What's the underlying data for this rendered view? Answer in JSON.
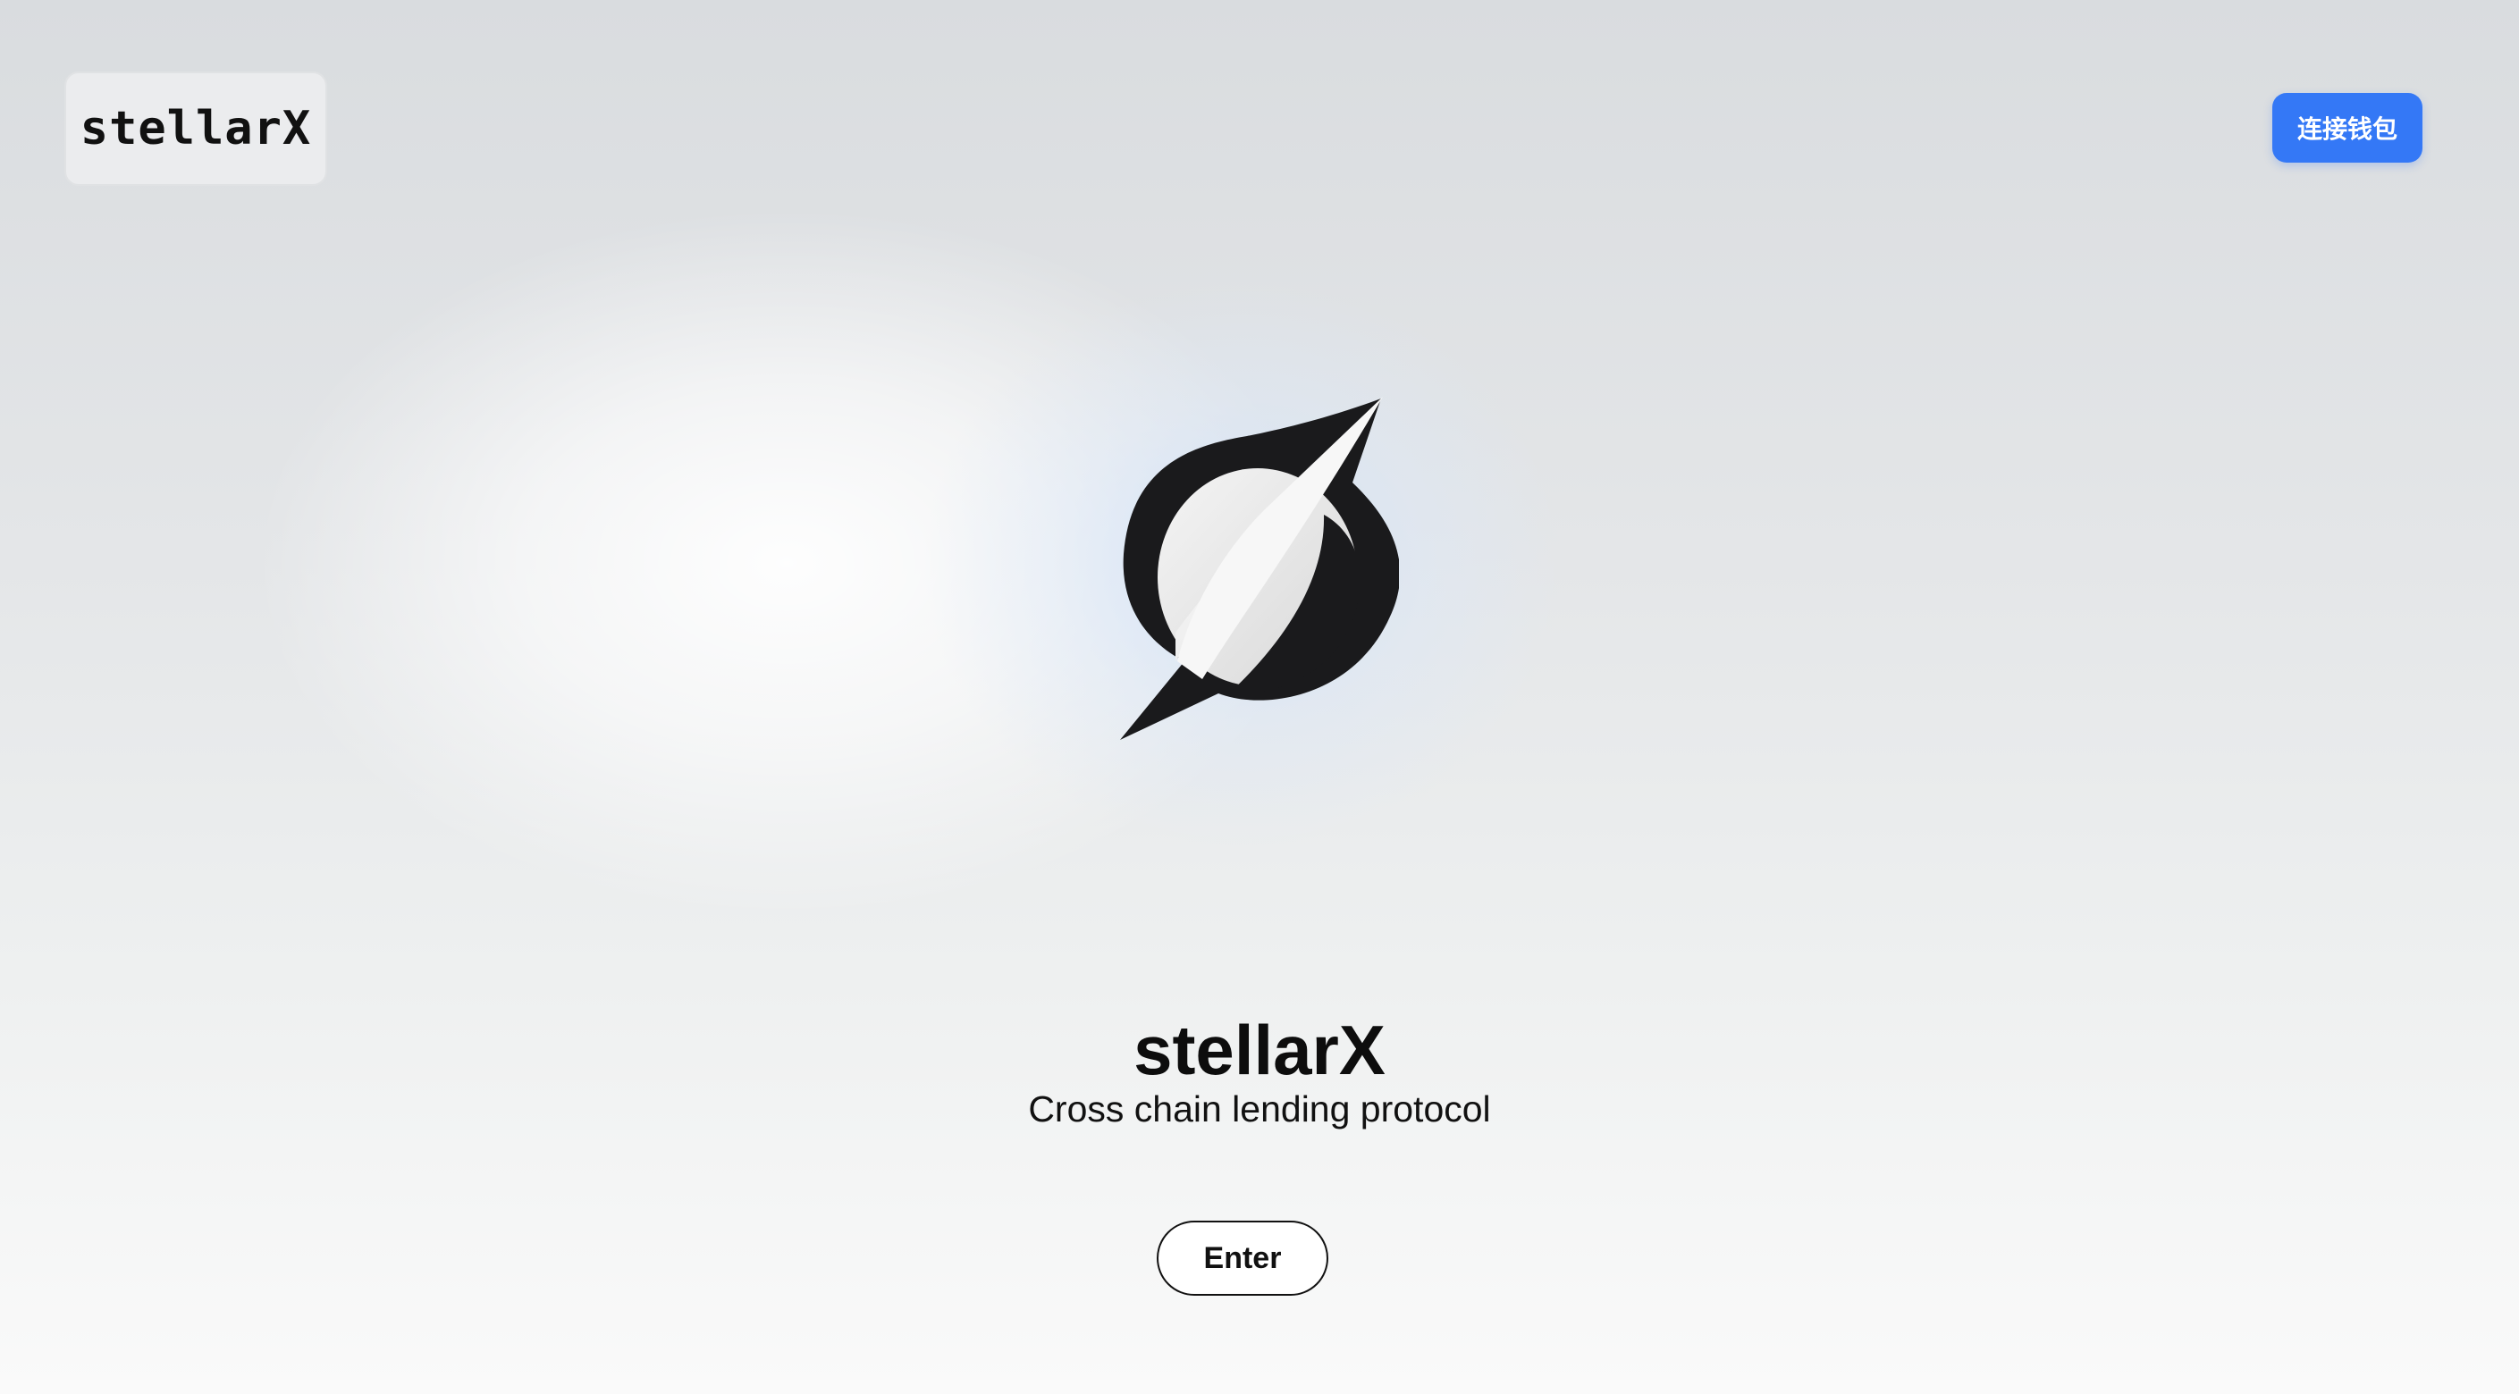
{
  "header": {
    "brand_label": "stellarX",
    "connect_wallet_label": "连接钱包"
  },
  "hero": {
    "logo": "stellarx-logo-icon",
    "title": "stellarX",
    "subtitle": "Cross chain lending protocol",
    "enter_label": "Enter"
  },
  "colors": {
    "accent": "#3478f6",
    "text": "#111111",
    "background_top": "#d9dcdf",
    "background_bottom": "#fafafa"
  }
}
